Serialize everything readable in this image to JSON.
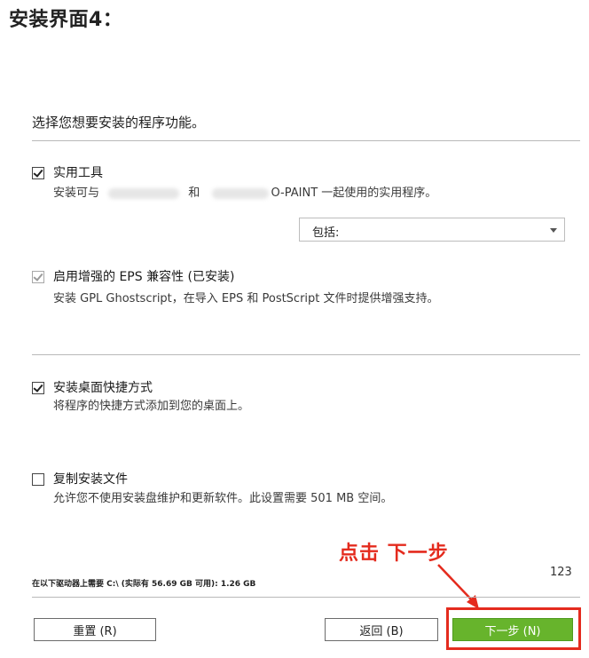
{
  "heading": "安装界面4：",
  "instruction": "选择您想要安装的程序功能。",
  "features": [
    {
      "title": "实用工具",
      "desc_prefix": "安装可与",
      "desc_mid": "和",
      "desc_suffix": "O-PAINT 一起使用的实用程序。",
      "checked": true,
      "disabled": false
    },
    {
      "title": "启用增强的 EPS 兼容性 (已安装)",
      "desc": "安装 GPL Ghostscript，在导入 EPS 和 PostScript 文件时提供增强支持。",
      "checked": true,
      "disabled": true
    },
    {
      "title": "安装桌面快捷方式",
      "desc": "将程序的快捷方式添加到您的桌面上。",
      "checked": true,
      "disabled": false
    },
    {
      "title": "复制安装文件",
      "desc": "允许您不使用安装盘维护和更新软件。此设置需要 501 MB 空间。",
      "checked": false,
      "disabled": false
    }
  ],
  "dropdown": {
    "value": "包括:"
  },
  "annotation": "点击 下一步",
  "page_counter": "123",
  "disk_info": "在以下驱动器上需要 C:\\ (实际有 56.69 GB 可用): 1.26 GB",
  "buttons": {
    "reset": "重置 (R)",
    "back": "返回 (B)",
    "next": "下一步 (N)"
  },
  "colors": {
    "accent_green": "#67b42c",
    "annotation_red": "#e42b1e"
  }
}
